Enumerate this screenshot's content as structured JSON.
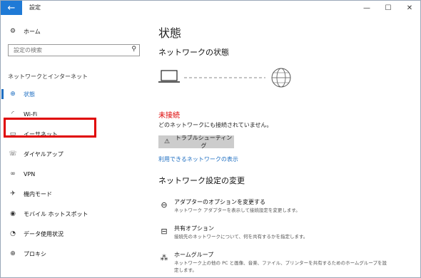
{
  "window": {
    "title": "設定"
  },
  "sidebar": {
    "home_label": "ホーム",
    "search_placeholder": "設定の検索",
    "section_title": "ネットワークとインターネット",
    "items": [
      {
        "label": "状態",
        "icon": "globe-status-icon",
        "active": true
      },
      {
        "label": "Wi-Fi",
        "icon": "wifi-icon",
        "active": false
      },
      {
        "label": "イーサネット",
        "icon": "ethernet-icon",
        "active": false
      },
      {
        "label": "ダイヤルアップ",
        "icon": "dialup-icon",
        "active": false
      },
      {
        "label": "VPN",
        "icon": "vpn-icon",
        "active": false
      },
      {
        "label": "機内モード",
        "icon": "airplane-icon",
        "active": false
      },
      {
        "label": "モバイル ホットスポット",
        "icon": "hotspot-icon",
        "active": false
      },
      {
        "label": "データ使用状況",
        "icon": "data-usage-icon",
        "active": false
      },
      {
        "label": "プロキシ",
        "icon": "globe-icon",
        "active": false
      }
    ]
  },
  "main": {
    "page_title": "状態",
    "network_status_heading": "ネットワークの状態",
    "status_text": "未接続",
    "status_description": "どのネットワークにも接続されていません。",
    "troubleshoot_label": "トラブルシューティング",
    "available_networks_link": "利用できるネットワークの表示",
    "change_settings_heading": "ネットワーク設定の変更",
    "options": [
      {
        "title": "アダプターのオプションを変更する",
        "desc": "ネットワーク アダプターを表示して接続設定を変更します。",
        "icon": "adapter-icon"
      },
      {
        "title": "共有オプション",
        "desc": "接続先のネットワークについて、何を共有するかを指定します。",
        "icon": "sharing-icon"
      },
      {
        "title": "ホームグループ",
        "desc": "ネットワーク上の他の PC と画像、音楽、ファイル、プリンターを共有するためのホームグループを設定します。",
        "icon": "homegroup-icon"
      }
    ]
  },
  "colors": {
    "accent": "#1f6fc2",
    "error": "#dd0000",
    "highlight_box": "#e00000"
  }
}
